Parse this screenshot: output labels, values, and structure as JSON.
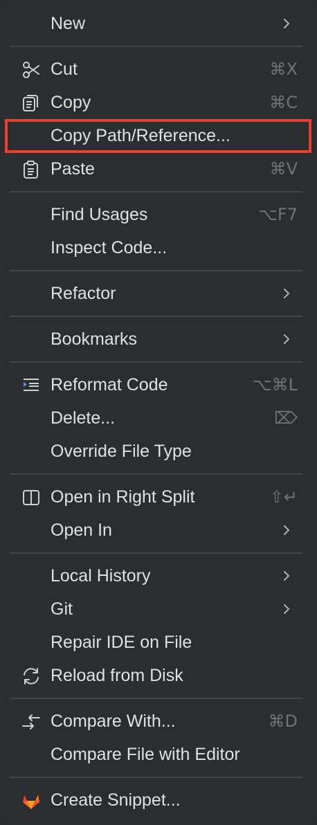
{
  "menu": {
    "items": [
      {
        "label": "New",
        "shortcut": "",
        "submenu": true,
        "icon": ""
      },
      {
        "label": "Cut",
        "shortcut": "⌘X",
        "submenu": false,
        "icon": "scissors-icon"
      },
      {
        "label": "Copy",
        "shortcut": "⌘C",
        "submenu": false,
        "icon": "copy-icon"
      },
      {
        "label": "Copy Path/Reference...",
        "shortcut": "",
        "submenu": false,
        "icon": ""
      },
      {
        "label": "Paste",
        "shortcut": "⌘V",
        "submenu": false,
        "icon": "clipboard-icon"
      },
      {
        "label": "Find Usages",
        "shortcut": "⌥F7",
        "submenu": false,
        "icon": ""
      },
      {
        "label": "Inspect Code...",
        "shortcut": "",
        "submenu": false,
        "icon": ""
      },
      {
        "label": "Refactor",
        "shortcut": "",
        "submenu": true,
        "icon": ""
      },
      {
        "label": "Bookmarks",
        "shortcut": "",
        "submenu": true,
        "icon": ""
      },
      {
        "label": "Reformat Code",
        "shortcut": "⌥⌘L",
        "submenu": false,
        "icon": "reformat-icon"
      },
      {
        "label": "Delete...",
        "shortcut": "⌦",
        "submenu": false,
        "icon": ""
      },
      {
        "label": "Override File Type",
        "shortcut": "",
        "submenu": false,
        "icon": ""
      },
      {
        "label": "Open in Right Split",
        "shortcut": "⇧↵",
        "submenu": false,
        "icon": "split-icon"
      },
      {
        "label": "Open In",
        "shortcut": "",
        "submenu": true,
        "icon": ""
      },
      {
        "label": "Local History",
        "shortcut": "",
        "submenu": true,
        "icon": ""
      },
      {
        "label": "Git",
        "shortcut": "",
        "submenu": true,
        "icon": ""
      },
      {
        "label": "Repair IDE on File",
        "shortcut": "",
        "submenu": false,
        "icon": ""
      },
      {
        "label": "Reload from Disk",
        "shortcut": "",
        "submenu": false,
        "icon": "reload-icon"
      },
      {
        "label": "Compare With...",
        "shortcut": "⌘D",
        "submenu": false,
        "icon": "compare-icon"
      },
      {
        "label": "Compare File with Editor",
        "shortcut": "",
        "submenu": false,
        "icon": ""
      },
      {
        "label": "Create Snippet...",
        "shortcut": "",
        "submenu": false,
        "icon": "gitlab-icon"
      }
    ],
    "highlighted_item": "Copy Path/Reference...",
    "colors": {
      "background": "#2b2d30",
      "text": "#dfe1e5",
      "shortcut": "#6f737a",
      "separator": "#43454a",
      "highlight_border": "#e8412f"
    }
  }
}
